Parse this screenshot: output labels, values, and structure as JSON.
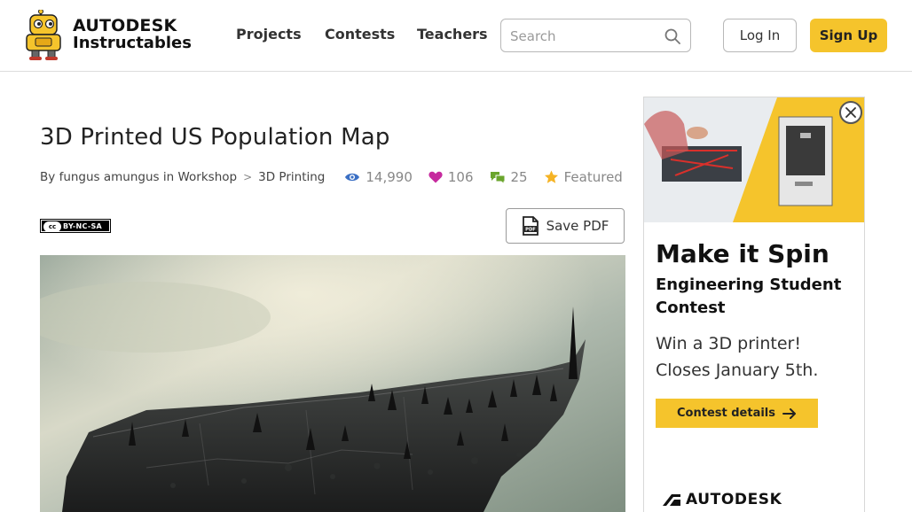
{
  "header": {
    "brand_line1": "AUTODESK",
    "brand_line2": "Instructables",
    "nav": [
      {
        "label": "Projects"
      },
      {
        "label": "Contests"
      },
      {
        "label": "Teachers"
      }
    ],
    "search": {
      "placeholder": "Search",
      "value": ""
    },
    "login_label": "Log In",
    "signup_label": "Sign Up"
  },
  "article": {
    "title": "3D Printed US Population Map",
    "by_label": "By",
    "author": "fungus amungus",
    "in_label": "in",
    "category": "Workshop",
    "breadcrumb_sep": ">",
    "subcategory": "3D Printing",
    "views": "14,990",
    "favorites": "106",
    "comments": "25",
    "featured_label": "Featured",
    "license": {
      "cc_label": "cc",
      "label": "BY-NC-SA"
    },
    "save_pdf_label": "Save PDF",
    "pdf_icon_label": "PDF"
  },
  "ad": {
    "headline": "Make it Spin",
    "subheadline": "Engineering Student Contest",
    "body_line1": "Win a 3D printer!",
    "body_line2": "Closes January 5th.",
    "cta_label": "Contest details",
    "brand": "AUTODESK"
  },
  "colors": {
    "accent": "#f5c42c",
    "views_icon": "#3a6fc4",
    "favorites_icon": "#c62a9e",
    "comments_icon": "#6aa52c",
    "featured_icon": "#f5b324"
  },
  "icons": [
    "robot-logo-icon",
    "search-icon",
    "eye-icon",
    "heart-icon",
    "comments-icon",
    "star-icon",
    "pdf-icon",
    "close-icon",
    "arrow-right-icon",
    "autodesk-logo-icon"
  ]
}
